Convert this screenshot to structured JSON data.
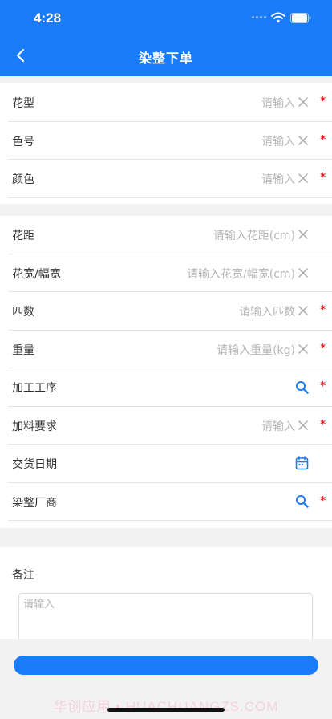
{
  "status_bar": {
    "time": "4:28"
  },
  "nav": {
    "title": "染整下单"
  },
  "section1": [
    {
      "label": "花型",
      "placeholder": "请输入",
      "type": "input",
      "required": "*"
    },
    {
      "label": "色号",
      "placeholder": "请输入",
      "type": "input",
      "required": "*"
    },
    {
      "label": "颜色",
      "placeholder": "请输入",
      "type": "input",
      "required": "*"
    }
  ],
  "section2": [
    {
      "label": "花距",
      "placeholder": "请输入花距(cm)",
      "type": "input",
      "required": ""
    },
    {
      "label": "花宽/幅宽",
      "placeholder": "请输入花宽/幅宽(cm)",
      "type": "input",
      "required": ""
    },
    {
      "label": "匹数",
      "placeholder": "请输入匹数",
      "type": "input",
      "required": "*"
    },
    {
      "label": "重量",
      "placeholder": "请输入重量(kg)",
      "type": "input",
      "required": "*"
    },
    {
      "label": "加工工序",
      "placeholder": "",
      "type": "search",
      "required": "*"
    },
    {
      "label": "加料要求",
      "placeholder": "请输入",
      "type": "input",
      "required": "*"
    },
    {
      "label": "交货日期",
      "placeholder": "",
      "type": "date",
      "required": ""
    },
    {
      "label": "染整厂商",
      "placeholder": "",
      "type": "search",
      "required": "*"
    }
  ],
  "remark": {
    "label": "备注",
    "placeholder": "请输入"
  },
  "watermark": "华创应用 • HUACHUANGZS.COM",
  "colors": {
    "primary": "#1a7cf8",
    "required": "#e02020",
    "placeholder": "#b5b5b5"
  },
  "icons": {
    "clear": "close-icon",
    "search": "search-icon",
    "date": "calendar-icon",
    "back": "chevron-left-icon"
  }
}
